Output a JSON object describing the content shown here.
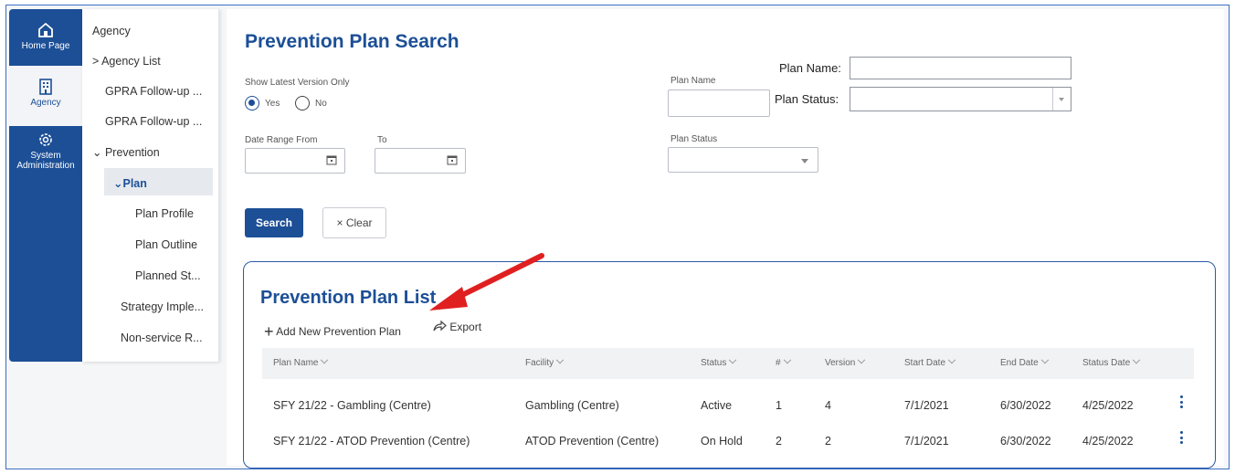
{
  "rail": {
    "items": [
      {
        "label": "Home Page",
        "icon": "home-icon"
      },
      {
        "label": "Agency",
        "icon": "building-icon"
      },
      {
        "label": "System Administration",
        "label_line1": "System",
        "label_line2": "Administration",
        "icon": "gear-icon"
      }
    ]
  },
  "submenu": {
    "items": [
      "Agency",
      "Agency List",
      "GPRA Follow-up ...",
      "GPRA Follow-up ...",
      "Prevention",
      "Plan",
      "Plan Profile",
      "Plan Outline",
      "Planned St...",
      "Strategy Imple...",
      "Non-service R..."
    ]
  },
  "search": {
    "title": "Prevention Plan Search",
    "latest_label": "Show Latest Version Only",
    "yes": "Yes",
    "no": "No",
    "date_from_label": "Date Range From",
    "to_label": "To",
    "plan_name_label": "Plan Name",
    "plan_status_label": "Plan Status",
    "search_button": "Search",
    "clear_button": "Clear"
  },
  "overlay": {
    "plan_name_label": "Plan Name:",
    "plan_status_label": "Plan Status:"
  },
  "list": {
    "title": "Prevention Plan List",
    "add_label": "Add New Prevention Plan",
    "export_label": "Export",
    "columns": [
      "Plan Name",
      "Facility",
      "Status",
      "#",
      "Version",
      "Start Date",
      "End Date",
      "Status Date"
    ],
    "rows": [
      [
        "SFY 21/22 - Gambling (Centre)",
        "Gambling (Centre)",
        "Active",
        "1",
        "4",
        "7/1/2021",
        "6/30/2022",
        "4/25/2022"
      ],
      [
        "SFY 21/22 - ATOD Prevention (Centre)",
        "ATOD Prevention (Centre)",
        "On Hold",
        "2",
        "2",
        "7/1/2021",
        "6/30/2022",
        "4/25/2022"
      ]
    ]
  },
  "colors": {
    "brand": "#1c4f96",
    "annotation_arrow": "#e02020"
  }
}
